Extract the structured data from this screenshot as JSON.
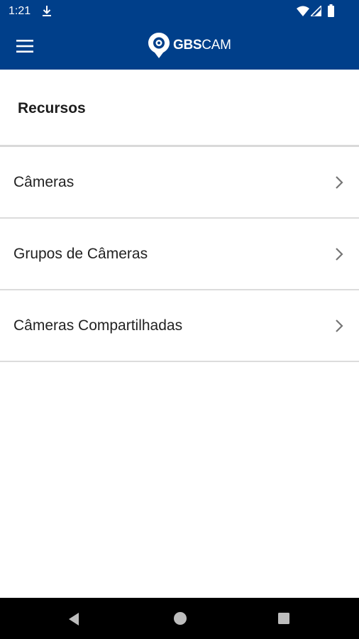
{
  "status_bar": {
    "time": "1:21",
    "icons": [
      "download-icon",
      "wifi-icon",
      "signal-icon",
      "battery-icon"
    ]
  },
  "app_bar": {
    "menu_icon": "hamburger-menu-icon",
    "logo_bold": "GBS",
    "logo_regular": "CAM"
  },
  "section": {
    "title": "Recursos"
  },
  "list": {
    "items": [
      {
        "label": "Câmeras",
        "icon": "chevron-right-icon"
      },
      {
        "label": "Grupos de Câmeras",
        "icon": "chevron-right-icon"
      },
      {
        "label": "Câmeras Compartilhadas",
        "icon": "chevron-right-icon"
      }
    ]
  },
  "nav_bar": {
    "icons": [
      "back-icon",
      "home-icon",
      "recents-icon"
    ]
  },
  "colors": {
    "primary": "#003F8A",
    "text": "#222222",
    "divider": "#DCDCDC",
    "chevron": "#757575"
  }
}
